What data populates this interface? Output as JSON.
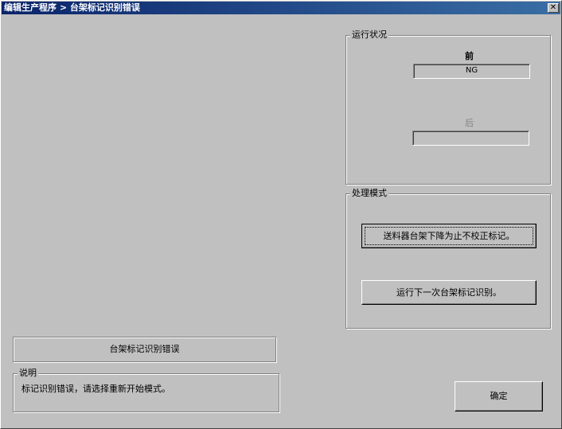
{
  "window": {
    "title": "编辑生产程序 > 台架标记识别错误",
    "close_glyph": "✕"
  },
  "run_status": {
    "label": "运行状况",
    "front_label": "前",
    "front_value": "NG",
    "rear_label": "后",
    "rear_value": ""
  },
  "process_mode": {
    "label": "处理模式",
    "button1": "送料器台架下降为止不校正标记。",
    "button2": "运行下一次台架标记识别。"
  },
  "error_title": "台架标记识别错误",
  "description": {
    "label": "说明",
    "text": "标记识别错误，请选择重新开始模式。"
  },
  "ok_button": "确定"
}
